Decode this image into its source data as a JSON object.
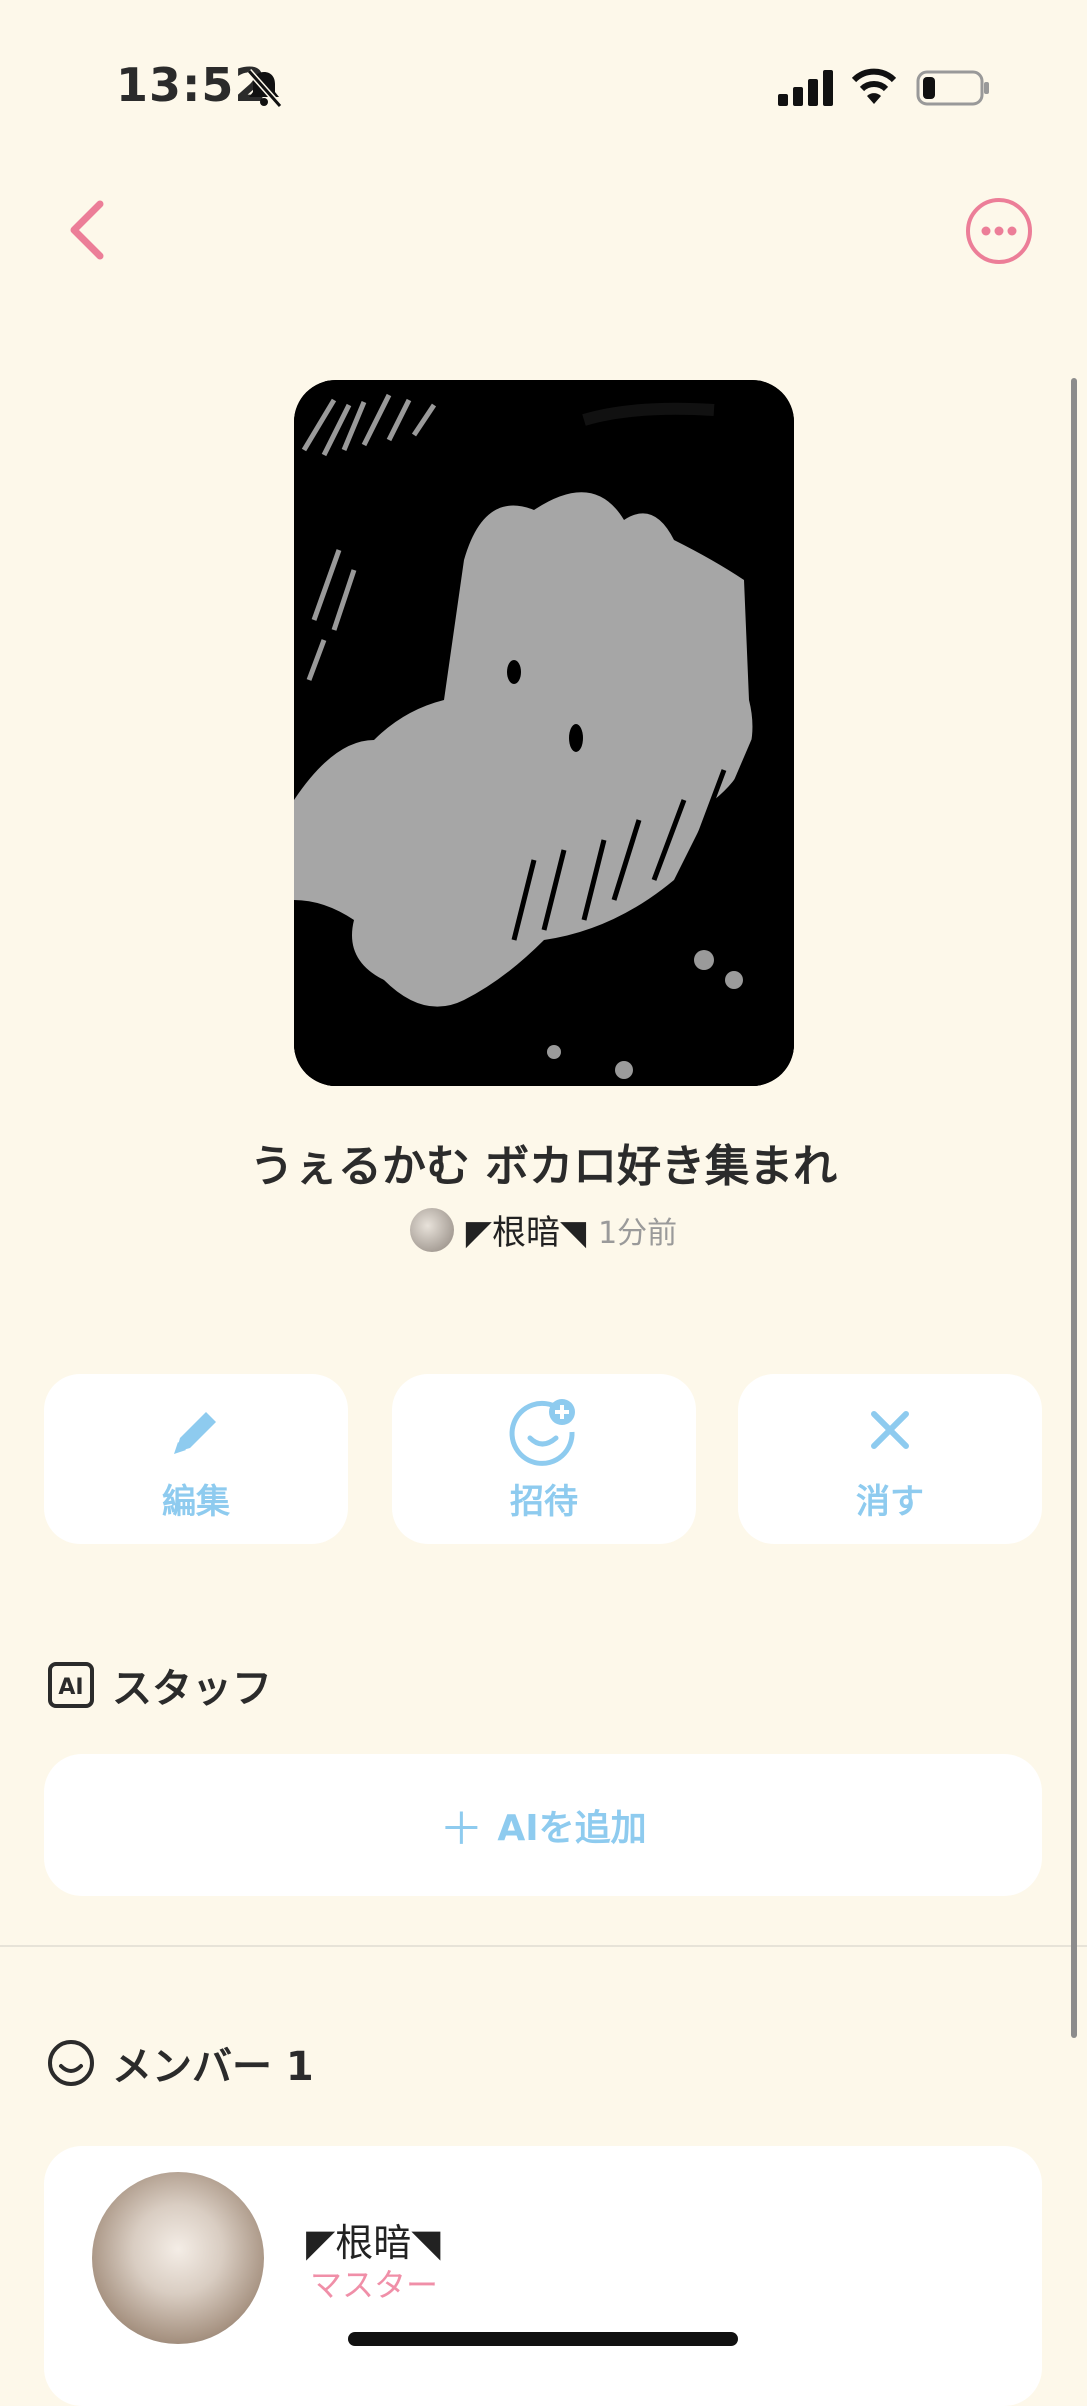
{
  "status_bar": {
    "time": "13:52"
  },
  "nav": {
    "back_icon": "chevron-left-icon",
    "more_icon": "more-horizontal-icon",
    "accent_color": "#ec7e98"
  },
  "room": {
    "title": "うぇるかむ ボカロ好き集まれ",
    "author": "◤根暗◥",
    "time_ago": "1分前"
  },
  "actions": [
    {
      "label": "編集",
      "icon": "pencil-icon"
    },
    {
      "label": "招待",
      "icon": "invite-icon"
    },
    {
      "label": "消す",
      "icon": "close-icon"
    }
  ],
  "staff": {
    "heading": "スタッフ",
    "icon": "ai-badge-icon",
    "add_label": "AIを追加",
    "add_plus": "＋"
  },
  "members": {
    "heading": "メンバー 1",
    "icon": "smile-icon",
    "list": [
      {
        "name": "◤根暗◥",
        "role": "マスター"
      }
    ]
  },
  "colors": {
    "background": "#fdf8ea",
    "button_text": "#8ecbef",
    "role_text": "#f08fa8"
  }
}
